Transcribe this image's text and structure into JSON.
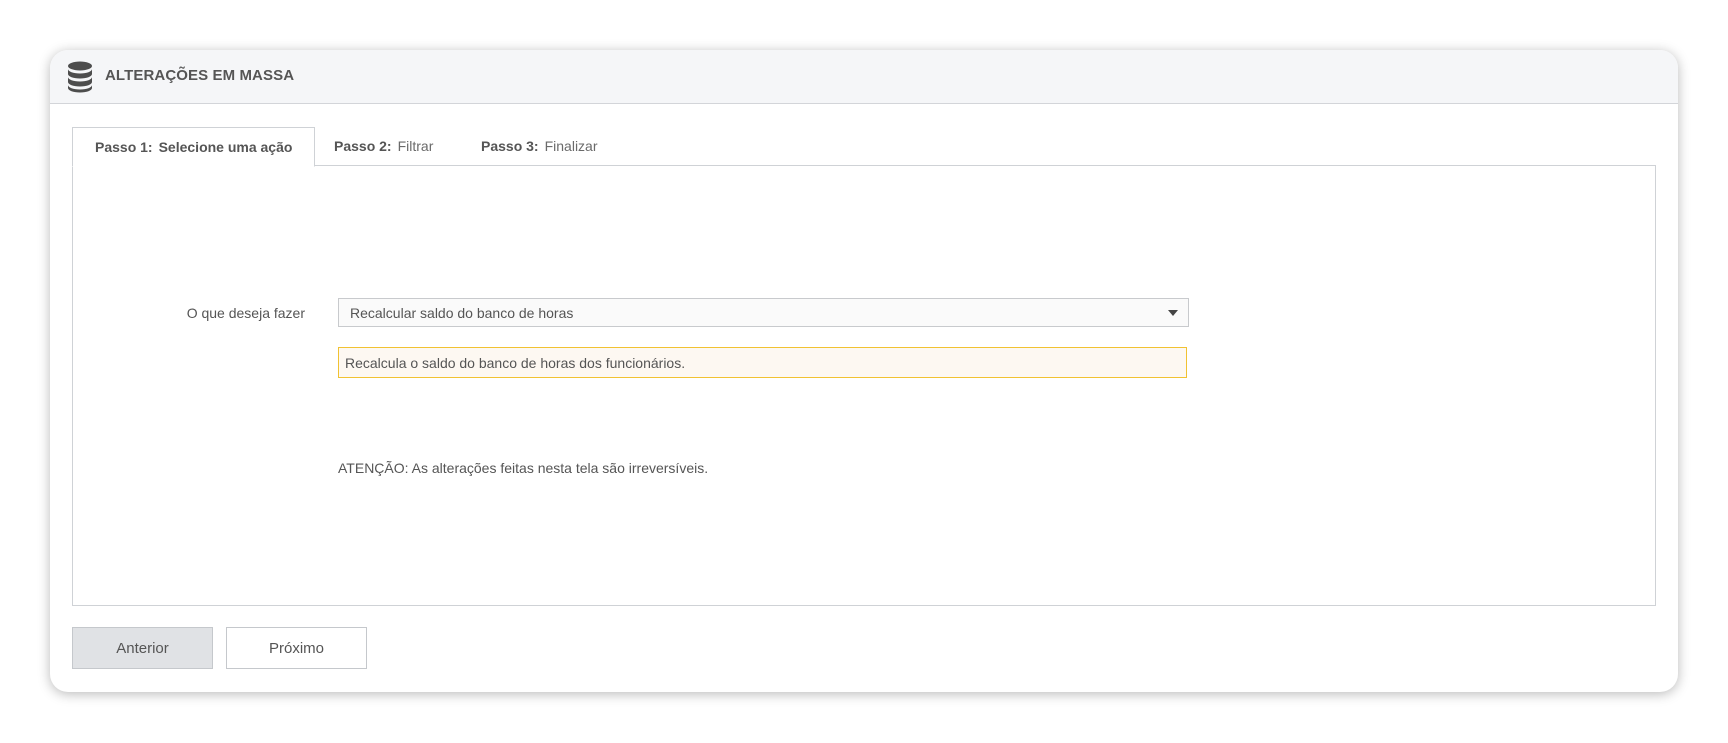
{
  "header": {
    "icon": "database-icon",
    "title": "ALTERAÇÕES EM MASSA"
  },
  "tabs": [
    {
      "step": "Passo 1:",
      "label": "Selecione uma ação",
      "active": true
    },
    {
      "step": "Passo 2:",
      "label": "Filtrar",
      "active": false
    },
    {
      "step": "Passo 3:",
      "label": "Finalizar",
      "active": false
    }
  ],
  "form": {
    "action_label": "O que deseja fazer",
    "action_value": "Recalcular saldo do banco de horas",
    "action_description": "Recalcula o saldo do banco de horas dos funcionários.",
    "warning": "ATENÇÃO: As alterações feitas nesta tela são irreversíveis."
  },
  "buttons": {
    "previous": "Anterior",
    "next": "Próximo"
  },
  "colors": {
    "header_bg": "#f5f6f8",
    "info_border": "#f1c232",
    "info_bg": "#fdf8f2",
    "disabled_button_bg": "#e0e2e5"
  }
}
